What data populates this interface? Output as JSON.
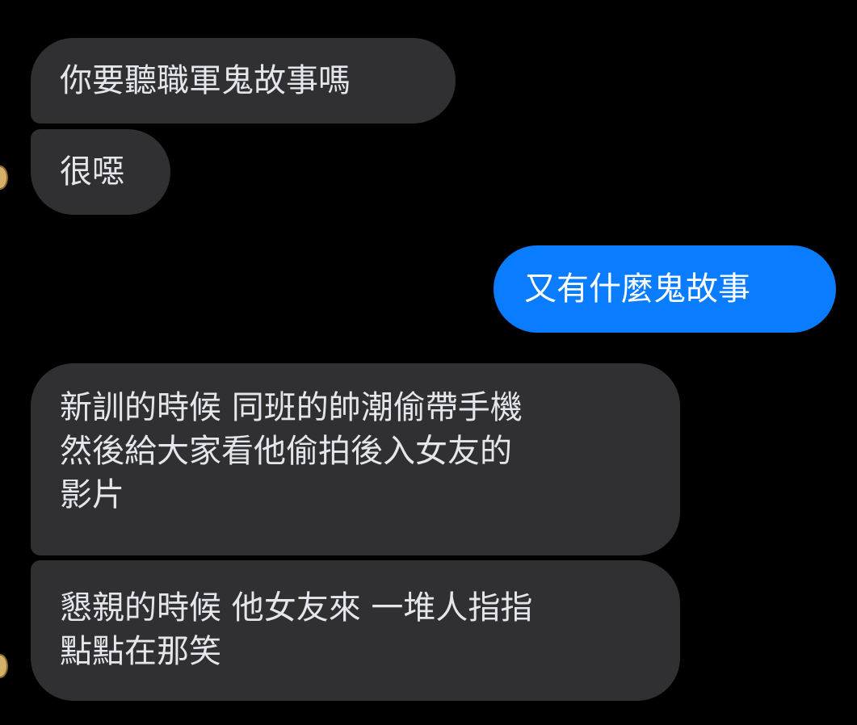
{
  "chat": {
    "messages": [
      {
        "direction": "incoming",
        "text": "你要聽職軍鬼故事嗎"
      },
      {
        "direction": "incoming",
        "text": "很噁"
      },
      {
        "direction": "outgoing",
        "text": "又有什麼鬼故事"
      },
      {
        "direction": "incoming",
        "text": "新訓的時候 同班的帥潮偷帶手機\n然後給大家看他偷拍後入女友的\n影片"
      },
      {
        "direction": "incoming",
        "text": "懇親的時候 他女友來 一堆人指指\n點點在那笑"
      }
    ]
  },
  "colors": {
    "background": "#000000",
    "incoming_bubble": "#303033",
    "outgoing_bubble": "#0a7cff",
    "incoming_text": "#e4e6eb",
    "outgoing_text": "#ffffff"
  }
}
